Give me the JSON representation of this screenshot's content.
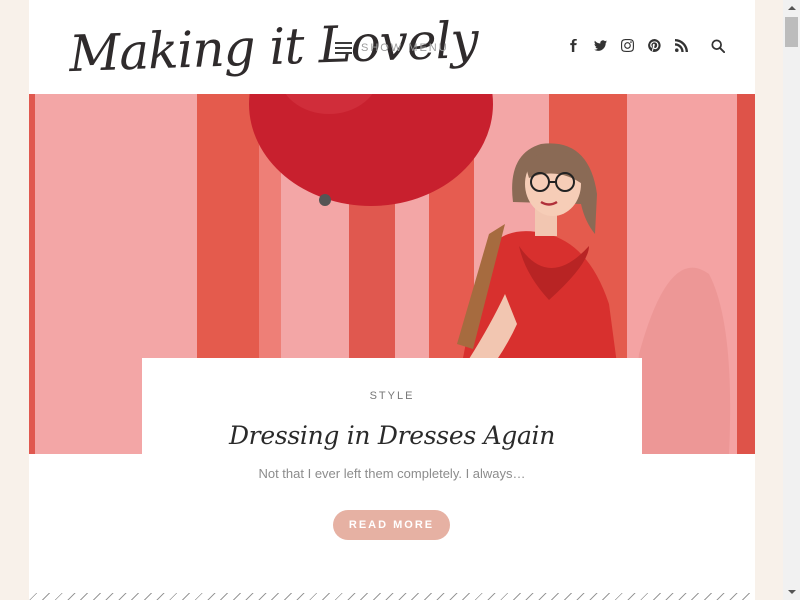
{
  "site": {
    "logo_text": "Making it Lovely"
  },
  "header": {
    "menu_label": "SHOW MENU",
    "social_icons": [
      "facebook-icon",
      "twitter-icon",
      "instagram-icon",
      "pinterest-icon",
      "rss-icon"
    ],
    "search_icon": "search-icon"
  },
  "post": {
    "category": "STYLE",
    "title": "Dressing in Dresses Again",
    "excerpt": "Not that I ever left them completely. I always…",
    "read_more_label": "READ MORE"
  },
  "colors": {
    "page_background": "#f8f1ea",
    "accent_button": "#e6b1a3",
    "hero_pink": "#f2a0a1",
    "hero_red": "#e0584f",
    "balloon": "#c8202e"
  }
}
